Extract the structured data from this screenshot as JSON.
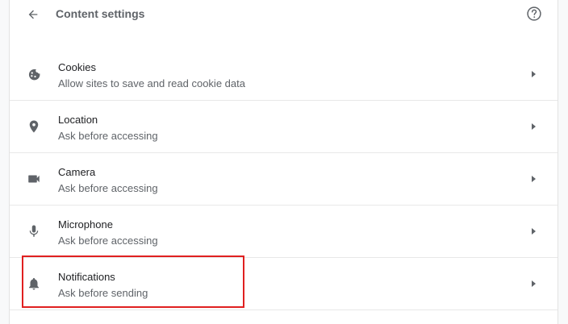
{
  "header": {
    "title": "Content settings",
    "back_icon": "arrow-back-icon",
    "help_icon": "help-circle-icon"
  },
  "items": [
    {
      "label": "Cookies",
      "sub": "Allow sites to save and read cookie data",
      "icon": "cookie-icon"
    },
    {
      "label": "Location",
      "sub": "Ask before accessing",
      "icon": "location-pin-icon"
    },
    {
      "label": "Camera",
      "sub": "Ask before accessing",
      "icon": "camera-icon"
    },
    {
      "label": "Microphone",
      "sub": "Ask before accessing",
      "icon": "microphone-icon"
    },
    {
      "label": "Notifications",
      "sub": "Ask before sending",
      "icon": "bell-icon"
    }
  ],
  "colors": {
    "icon": "#5f6368",
    "highlight": "#e02020"
  }
}
